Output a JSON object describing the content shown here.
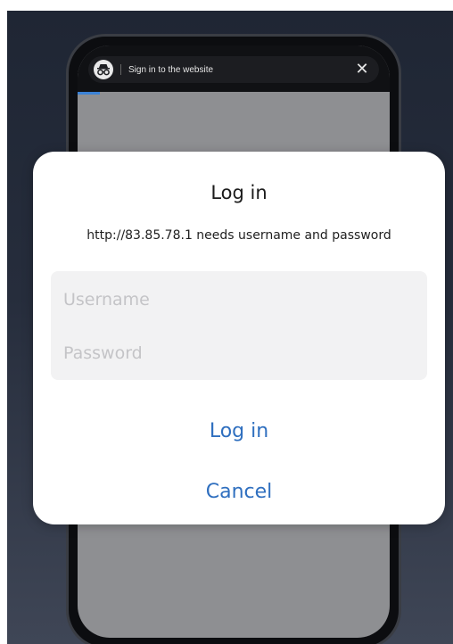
{
  "browser": {
    "tab_title": "Sign in to the website",
    "close_glyph": "✕",
    "incognito_icon": "incognito-glasses-icon",
    "progress": 0.07,
    "accent_color": "#3b82d6"
  },
  "dialog": {
    "title": "Log in",
    "message": "http://83.85.78.1 needs username and password",
    "username_placeholder": "Username",
    "username_value": "",
    "password_placeholder": "Password",
    "password_value": "",
    "login_label": "Log in",
    "cancel_label": "Cancel",
    "button_color": "#2f6fbf"
  }
}
